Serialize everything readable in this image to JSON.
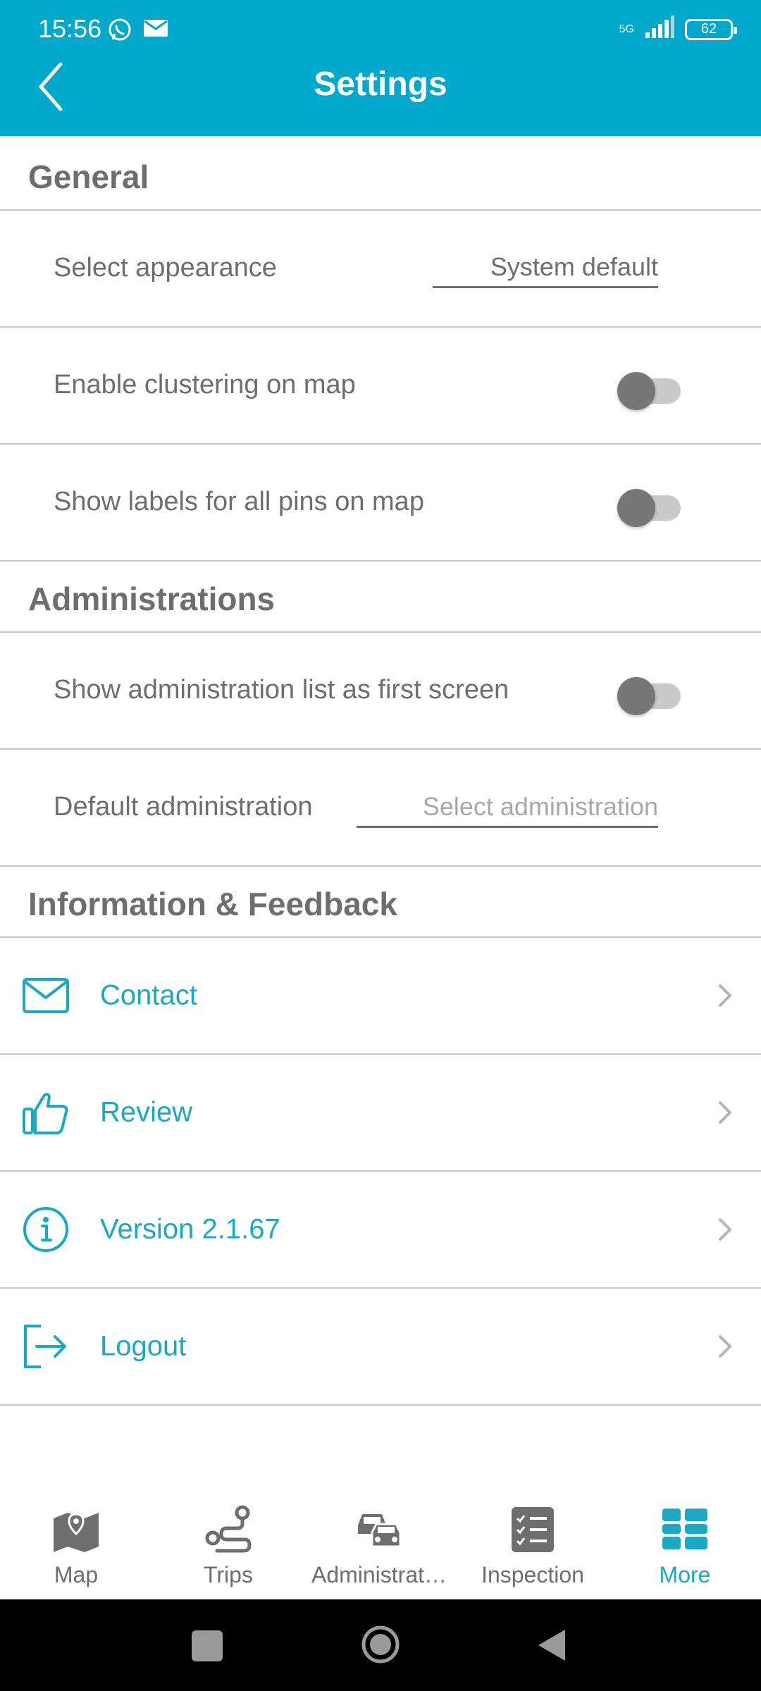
{
  "status_bar": {
    "time": "15:56",
    "network": "5G",
    "battery": "62"
  },
  "header": {
    "title": "Settings"
  },
  "sections": {
    "general": {
      "title": "General",
      "appearance_label": "Select appearance",
      "appearance_value": "System default",
      "clustering_label": "Enable clustering on map",
      "clustering_enabled": false,
      "labels_label": "Show labels for all pins on map",
      "labels_enabled": false
    },
    "administrations": {
      "title": "Administrations",
      "first_screen_label": "Show administration list as first screen",
      "first_screen_enabled": false,
      "default_label": "Default administration",
      "default_placeholder": "Select administration"
    },
    "info": {
      "title": "Information & Feedback",
      "contact": "Contact",
      "review": "Review",
      "version": "Version 2.1.67",
      "logout": "Logout"
    }
  },
  "bottom_nav": {
    "map": "Map",
    "trips": "Trips",
    "administrations": "Administrat…",
    "inspection": "Inspection",
    "more": "More"
  },
  "colors": {
    "accent": "#00A9CB",
    "link": "#1AA9C5",
    "text": "#6E6E6E",
    "toggle_off": "#777777"
  }
}
